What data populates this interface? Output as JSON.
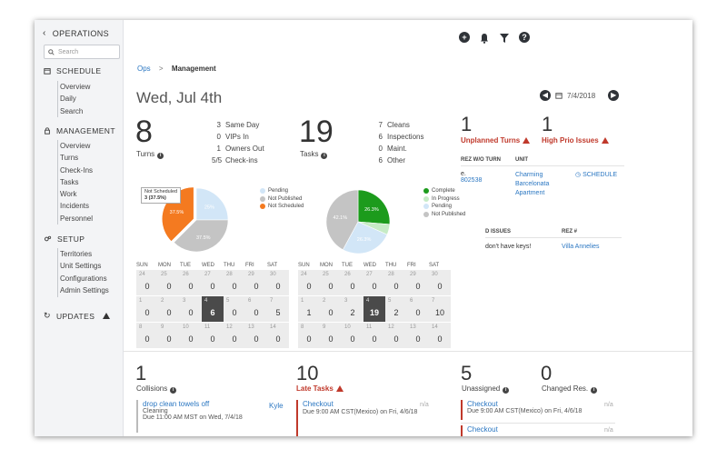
{
  "sidebar": {
    "header": "OPERATIONS",
    "search_placeholder": "Search",
    "sections": [
      {
        "label": "SCHEDULE",
        "items": [
          "Overview",
          "Daily",
          "Search"
        ]
      },
      {
        "label": "MANAGEMENT",
        "items": [
          "Overview",
          "Turns",
          "Check-Ins",
          "Tasks",
          "Work",
          "Incidents",
          "Personnel"
        ]
      },
      {
        "label": "SETUP",
        "items": [
          "Territories",
          "Unit Settings",
          "Configurations",
          "Admin Settings"
        ]
      },
      {
        "label": "UPDATES"
      }
    ]
  },
  "breadcrumb": {
    "root": "Ops",
    "sep": ">",
    "current": "Management"
  },
  "page_title": "Wed, Jul 4th",
  "date_value": "7/4/2018",
  "turns": {
    "count": "8",
    "label": "Turns",
    "stats": [
      {
        "n": "3",
        "label": "Same Day"
      },
      {
        "n": "0",
        "label": "VIPs In"
      },
      {
        "n": "1",
        "label": "Owners Out"
      },
      {
        "n": "5/5",
        "label": "Check-ins"
      }
    ]
  },
  "tasks": {
    "count": "19",
    "label": "Tasks",
    "stats": [
      {
        "n": "7",
        "label": "Cleans"
      },
      {
        "n": "6",
        "label": "Inspections"
      },
      {
        "n": "0",
        "label": "Maint."
      },
      {
        "n": "6",
        "label": "Other"
      }
    ]
  },
  "unplanned": {
    "count": "1",
    "label": "Unplanned Turns"
  },
  "highprio": {
    "count": "1",
    "label": "High Prio Issues"
  },
  "turns_chart": {
    "tooltip_title": "Not Scheduled",
    "tooltip_value": "3 (37.5%)",
    "slice_labels": [
      "25%",
      "37.5%",
      "37.5%"
    ],
    "legend": [
      "Pending",
      "Not Published",
      "Not Scheduled"
    ],
    "colors": [
      "#d2e6f7",
      "#c4c4c4",
      "#f47a20"
    ]
  },
  "tasks_chart": {
    "slice_labels": [
      "26.3%",
      "26.3%",
      "42.1%"
    ],
    "legend": [
      "Complete",
      "In Progress",
      "Pending",
      "Not Published"
    ],
    "colors": [
      "#1c9b1c",
      "#c6ebc6",
      "#d2e6f7",
      "#c4c4c4"
    ]
  },
  "chart_data": [
    {
      "type": "pie",
      "title": "Turns",
      "categories": [
        "Pending",
        "Not Published",
        "Not Scheduled"
      ],
      "values": [
        25,
        37.5,
        37.5
      ]
    },
    {
      "type": "pie",
      "title": "Tasks",
      "categories": [
        "Complete",
        "In Progress",
        "Pending",
        "Not Published"
      ],
      "values": [
        26.3,
        5.3,
        26.3,
        42.1
      ]
    }
  ],
  "cal_days": [
    "SUN",
    "MON",
    "TUE",
    "WED",
    "THU",
    "FRI",
    "SAT"
  ],
  "cal_dates": [
    [
      "24",
      "25",
      "26",
      "27",
      "28",
      "29",
      "30"
    ],
    [
      "1",
      "2",
      "3",
      "4",
      "5",
      "6",
      "7"
    ],
    [
      "8",
      "9",
      "10",
      "11",
      "12",
      "13",
      "14"
    ]
  ],
  "turns_cal": [
    [
      "0",
      "0",
      "0",
      "0",
      "0",
      "0",
      "0"
    ],
    [
      "0",
      "0",
      "0",
      "6",
      "0",
      "0",
      "5"
    ],
    [
      "0",
      "0",
      "0",
      "0",
      "0",
      "0",
      "0"
    ]
  ],
  "tasks_cal": [
    [
      "0",
      "0",
      "0",
      "0",
      "0",
      "0",
      "0"
    ],
    [
      "1",
      "0",
      "2",
      "19",
      "2",
      "0",
      "10"
    ],
    [
      "0",
      "0",
      "0",
      "0",
      "0",
      "0",
      "0"
    ]
  ],
  "rez_table": {
    "headers": [
      "REZ W/O TURN",
      "UNIT"
    ],
    "rez": "802538",
    "rez_prefix": "e.",
    "unit": "Charming Barcelonata Apartment",
    "action": "SCHEDULE"
  },
  "issues_table": {
    "headers": [
      "D ISSUES",
      "REZ #"
    ],
    "issue": "don't have keys!",
    "rez": "Villa Annelies"
  },
  "bottom": {
    "collisions": {
      "count": "1",
      "label": "Collisions",
      "item_title": "drop clean towels off",
      "item_type": "Cleaning",
      "item_due": "Due 11:00 AM MST on Wed, 7/4/18",
      "item_person": "Kyle"
    },
    "late": {
      "count": "10",
      "label": "Late Tasks",
      "item_title": "Checkout",
      "item_due": "Due 9:00 AM CST(Mexico) on Fri, 4/6/18",
      "na": "n/a"
    },
    "unassigned": {
      "count": "5",
      "label": "Unassigned",
      "item_title": "Checkout",
      "item_due": "Due 9:00 AM CST(Mexico) on Fri, 4/6/18",
      "item2_title": "Checkout",
      "na": "n/a",
      "na2": "n/a"
    },
    "changed": {
      "count": "0",
      "label": "Changed Res."
    }
  }
}
